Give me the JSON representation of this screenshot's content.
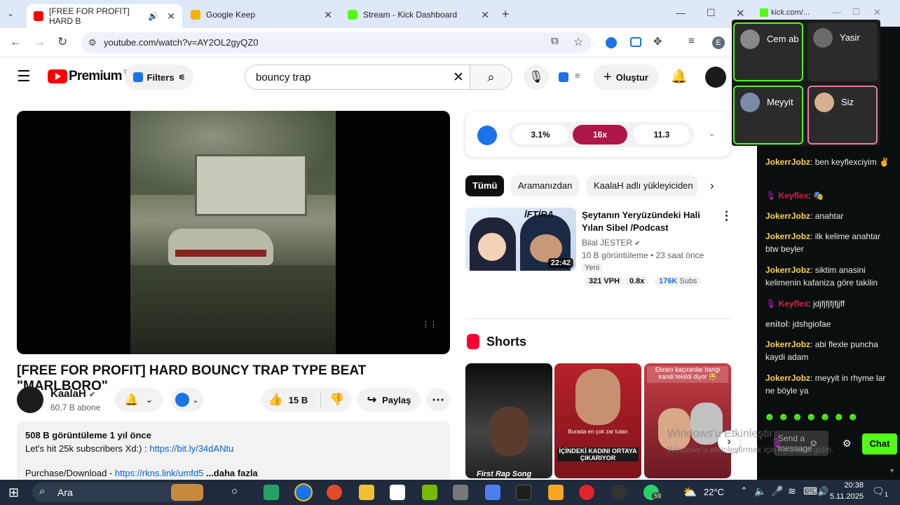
{
  "browser": {
    "tabs": [
      {
        "title": "[FREE FOR PROFIT] HARD B",
        "active": true,
        "color": "#ff0000"
      },
      {
        "title": "Google Keep",
        "active": false,
        "color": "#f5b400"
      },
      {
        "title": "Stream - Kick Dashboard",
        "active": false,
        "color": "#53fc18"
      }
    ],
    "url": "youtube.com/watch?v=AY2OL2gyQZ0",
    "profile_initial": "E"
  },
  "youtube": {
    "logo_text": "Premium",
    "logo_sup": "TR",
    "filters_label": "Filters",
    "search_value": "bouncy trap",
    "create_label": "Oluştur",
    "video_title": "[FREE FOR PROFIT] HARD BOUNCY TRAP TYPE BEAT \"MARLBORO\"",
    "channel_name": "KaalaH",
    "subscribers": "60,7 B abone",
    "likes": "15 B",
    "share_label": "Paylaş",
    "desc_meta": "508 B görüntüleme  1 yıl önce",
    "desc_line1": "Let's hit 25k subscribers Xd:) : ",
    "desc_link1": "https://bit.ly/34dANtu",
    "desc_line2": "Purchase/Download - ",
    "desc_link2": "https://rkns.link/umfd5",
    "desc_more": " ...daha fazla",
    "stats_pills": [
      "3.1%",
      "16x",
      "11.3"
    ],
    "chips": [
      "Tümü",
      "Aramanızdan",
      "KaalaH adlı yükleyiciden"
    ],
    "rec": {
      "title": "Şeytanın Yeryüzündeki Hali Yılan Sibel /Podcast",
      "channel": "Bilal JESTER",
      "meta": "10 B görüntüleme • 23 saat önce",
      "badge": "Yeni",
      "duration": "22:42",
      "thumb_text": "İFTİRA",
      "vph": "321 VPH",
      "ratio": "0.8x",
      "subs_num": "176K",
      "subs_label": "Subs"
    },
    "shorts_label": "Shorts",
    "shorts": [
      {
        "caption": "First Rap Song"
      },
      {
        "caption": "İÇİNDEKİ KADINI ORTAYA ÇIKARIYOR",
        "top": "Burada en çok zar tutan"
      },
      {
        "caption": "",
        "top": "Ekranı kaçıranlar hangi kandi tekildi diyor 😂"
      }
    ]
  },
  "kick": {
    "url": "kick.com/...",
    "participants": [
      {
        "name": "Cem ab",
        "border": "#53fc18"
      },
      {
        "name": "Yasir",
        "border": "#2b2b2b"
      },
      {
        "name": "Meyyit",
        "border": "#53fc18"
      },
      {
        "name": "Siz",
        "border": "#e879a6"
      }
    ],
    "messages": [
      {
        "user": "JokerrJobz",
        "text": "ben keyflexciyim ✌",
        "type": "u"
      },
      {
        "user": "Keyflex",
        "text": "🎭",
        "type": "k"
      },
      {
        "user": "JokerrJobz",
        "text": "anahtar",
        "type": "u"
      },
      {
        "user": "JokerrJobz",
        "text": "ilk kelime anahtar btw beyler",
        "type": "u"
      },
      {
        "user": "JokerrJobz",
        "text": "siktim anasini kelimenin kafaniza göre takilin",
        "type": "u"
      },
      {
        "user": "Keyflex",
        "text": "jdjfjfjfjfjjff",
        "type": "k"
      },
      {
        "user": "enitol",
        "text": "jdshgiofae",
        "type": "g"
      },
      {
        "user": "JokerrJobz",
        "text": "abi flexle puncha kaydi adam",
        "type": "u"
      },
      {
        "user": "JokerrJobz",
        "text": "meyyit in rhyme lar ne böyle ya",
        "type": "u"
      }
    ],
    "input_placeholder": "Send a message",
    "chat_button": "Chat",
    "watermark_1": "Windows'u Etkinleştir",
    "watermark_2": "Windows'u etkinleştirmek için Ayarlar'a gidin."
  },
  "taskbar": {
    "search": "Ara",
    "weather": "22°C",
    "time": "20:38",
    "date": "5.11.2025",
    "whatsapp_badge": "59",
    "notif": "1"
  }
}
